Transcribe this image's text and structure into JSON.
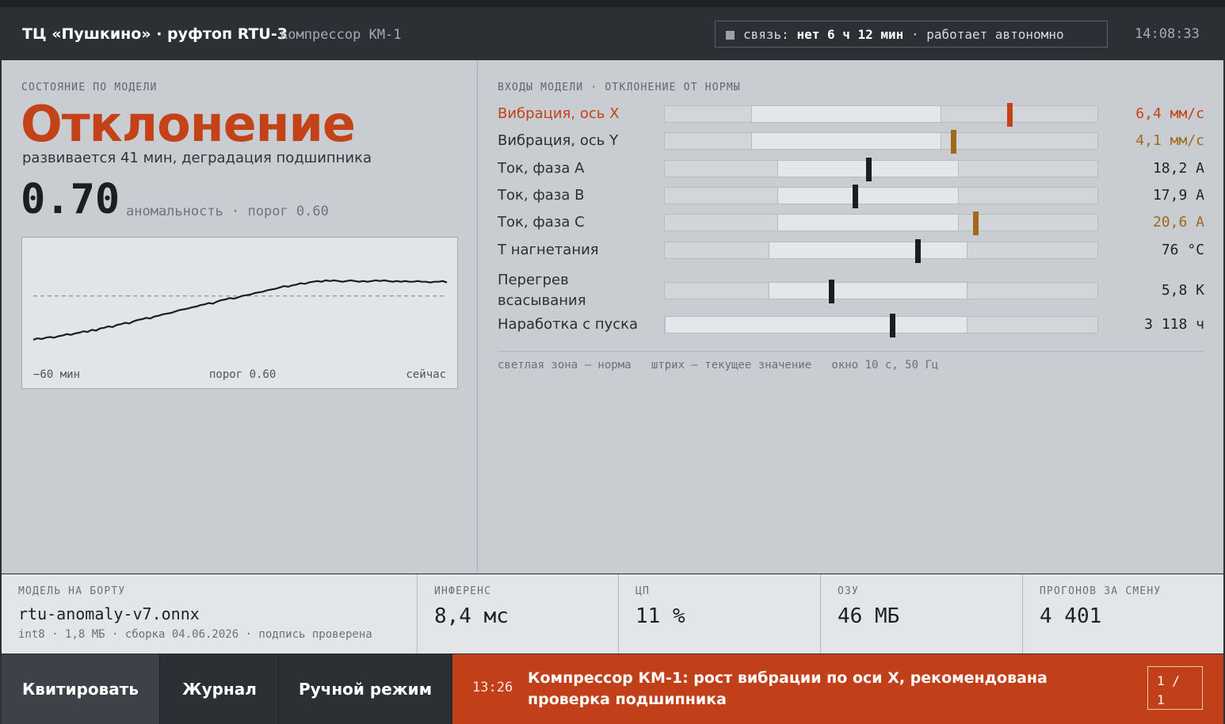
{
  "header": {
    "site_title": "ТЦ «Пушкино» · руфтоп RTU-3",
    "device": "компрессор КМ-1",
    "link_label": "связь:",
    "link_value": "нет 6 ч 12 мин",
    "link_mode": "· работает автономно",
    "clock": "14:08:33"
  },
  "state": {
    "caption": "СОСТОЯНИЕ ПО МОДЕЛИ",
    "label": "Отклонение",
    "description": "развивается 41 мин, деградация подшипника",
    "score": "0.70",
    "score_caption": "аномальность · порог 0.60",
    "color": "#c44217"
  },
  "chart_data": {
    "type": "line",
    "x_start_label": "−60 мин",
    "threshold_label": "порог 0.60",
    "x_end_label": "сейчас",
    "threshold": 0.6,
    "ylim": [
      0.2,
      0.9
    ],
    "series": [
      {
        "values": [
          0.29,
          0.3,
          0.295,
          0.305,
          0.31,
          0.305,
          0.315,
          0.32,
          0.33,
          0.325,
          0.335,
          0.34,
          0.35,
          0.345,
          0.36,
          0.355,
          0.37,
          0.375,
          0.385,
          0.38,
          0.395,
          0.4,
          0.41,
          0.405,
          0.42,
          0.43,
          0.435,
          0.445,
          0.44,
          0.455,
          0.46,
          0.47,
          0.475,
          0.48,
          0.49,
          0.5,
          0.505,
          0.51,
          0.52,
          0.525,
          0.535,
          0.54,
          0.55,
          0.545,
          0.56,
          0.57,
          0.575,
          0.585,
          0.58,
          0.59,
          0.6,
          0.605,
          0.61,
          0.62,
          0.625,
          0.63,
          0.64,
          0.645,
          0.65,
          0.66,
          0.67,
          0.665,
          0.675,
          0.68,
          0.69,
          0.685,
          0.695,
          0.7,
          0.705,
          0.7,
          0.71,
          0.705,
          0.71,
          0.705,
          0.7,
          0.705,
          0.71,
          0.705,
          0.7,
          0.705,
          0.7,
          0.705,
          0.71,
          0.705,
          0.71,
          0.705,
          0.7,
          0.705,
          0.7,
          0.705,
          0.7,
          0.7,
          0.705,
          0.7,
          0.7,
          0.695,
          0.7,
          0.7,
          0.705,
          0.695
        ]
      }
    ]
  },
  "inputs": {
    "caption": "ВХОДЫ МОДЕЛИ · ОТКЛОНЕНИЕ ОТ НОРМЫ",
    "rows": [
      {
        "name": "Вибрация, ось X",
        "value": "6,4 мм/с",
        "norm": [
          0.2,
          0.64
        ],
        "pos": 0.797,
        "status": "alarm"
      },
      {
        "name": "Вибрация, ось Y",
        "value": "4,1 мм/с",
        "norm": [
          0.2,
          0.64
        ],
        "pos": 0.666,
        "status": "warn"
      },
      {
        "name": "Ток, фаза A",
        "value": "18,2 A",
        "norm": [
          0.26,
          0.68
        ],
        "pos": 0.47,
        "status": "ok"
      },
      {
        "name": "Ток, фаза B",
        "value": "17,9 A",
        "norm": [
          0.26,
          0.68
        ],
        "pos": 0.44,
        "status": "ok"
      },
      {
        "name": "Ток, фаза C",
        "value": "20,6 A",
        "norm": [
          0.26,
          0.68
        ],
        "pos": 0.718,
        "status": "warn"
      },
      {
        "name": "T нагнетания",
        "value": "76 °C",
        "norm": [
          0.24,
          0.7
        ],
        "pos": 0.585,
        "status": "ok"
      },
      {
        "name": "Перегрев всасывания",
        "value": "5,8 K",
        "norm": [
          0.24,
          0.7
        ],
        "pos": 0.385,
        "status": "ok"
      },
      {
        "name": "Наработка с пуска",
        "value": "3 118 ч",
        "norm": [
          0.0,
          0.7
        ],
        "pos": 0.525,
        "status": "ok"
      }
    ],
    "legend": "светлая зона — норма   штрих — текущее значение   окно 10 с, 50 Гц",
    "colors": {
      "ok": "#1b1e21",
      "warn": "#a06a1a",
      "alarm": "#c44217"
    }
  },
  "stats": {
    "model_caption": "МОДЕЛЬ НА БОРТУ",
    "model_file": "rtu-anomaly-v7.onnx",
    "model_meta": "int8 · 1,8 МБ · сборка 04.06.2026 · подпись проверена",
    "inference_caption": "ИНФЕРЕНС",
    "inference_value": "8,4 мс",
    "cpu_caption": "ЦП",
    "cpu_value": "11 %",
    "ram_caption": "ОЗУ",
    "ram_value": "46 МБ",
    "runs_caption": "ПРОГОНОВ ЗА СМЕНУ",
    "runs_value": "4 401"
  },
  "actions": {
    "ack": "Квитировать",
    "log": "Журнал",
    "manual": "Ручной режим"
  },
  "alert": {
    "time": "13:26",
    "text": "Компрессор КМ-1: рост вибрации по оси X, рекомендована проверка подшипника",
    "pager": "1 / 1",
    "color": "#c1401a"
  }
}
